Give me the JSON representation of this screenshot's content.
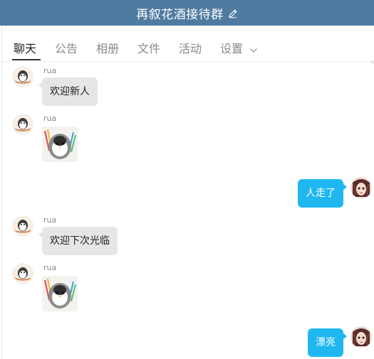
{
  "window": {
    "title": "再叙花酒接待群",
    "edit_icon": "edit-icon"
  },
  "tabs": [
    {
      "label": "聊天",
      "active": true
    },
    {
      "label": "公告",
      "active": false
    },
    {
      "label": "相册",
      "active": false
    },
    {
      "label": "文件",
      "active": false
    },
    {
      "label": "活动",
      "active": false
    },
    {
      "label": "设置",
      "active": false,
      "icon": "chevron-down-icon"
    }
  ],
  "messages": [
    {
      "side": "left",
      "sender": "rua",
      "type": "text",
      "text": "欢迎新人"
    },
    {
      "side": "left",
      "sender": "rua",
      "type": "sticker",
      "sticker": "penguin-sticker"
    },
    {
      "side": "right",
      "type": "text",
      "text": "人走了"
    },
    {
      "side": "left",
      "sender": "rua",
      "type": "text",
      "text": "欢迎下次光临"
    },
    {
      "side": "left",
      "sender": "rua",
      "type": "sticker",
      "sticker": "penguin-sticker"
    },
    {
      "side": "right",
      "type": "text",
      "text": "漂亮"
    }
  ],
  "colors": {
    "titlebar": "#4f7ba1",
    "bubble_left": "#e6e6e6",
    "bubble_right": "#20b7f0"
  }
}
